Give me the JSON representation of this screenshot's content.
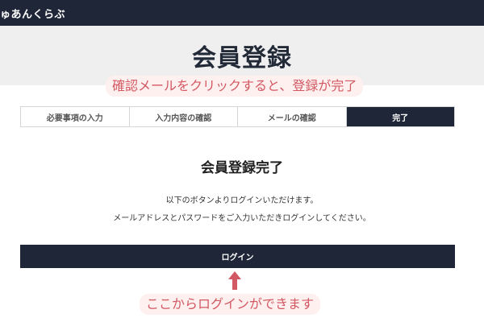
{
  "header": {
    "site_name": "ゅあんくらぶ"
  },
  "hero": {
    "title": "会員登録"
  },
  "annotations": {
    "top_callout": "確認メールをクリックすると、登録が完了",
    "bottom_callout": "ここからログインができます",
    "arrow": "arrow-up-icon",
    "callout_color": "#d25863"
  },
  "steps": [
    {
      "label": "必要事項の入力",
      "active": false
    },
    {
      "label": "入力内容の確認",
      "active": false
    },
    {
      "label": "メールの確認",
      "active": false
    },
    {
      "label": "完了",
      "active": true
    }
  ],
  "main": {
    "complete_title": "会員登録完了",
    "message_line1": "以下のボタンよりログインいただけます。",
    "message_line2": "メールアドレスとパスワードをご入力いただきログインしてください。",
    "login_button": "ログイン"
  },
  "colors": {
    "navy": "#1f2638",
    "hero_bg": "#efefef",
    "accent": "#d25863"
  }
}
